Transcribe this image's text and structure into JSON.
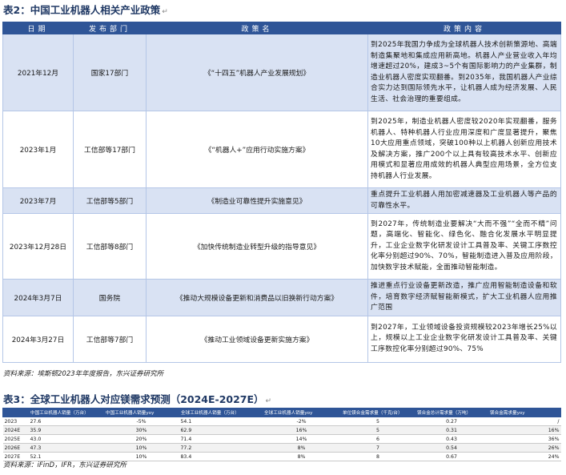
{
  "table1": {
    "title": "表2：中国工业机器人相关产业政策",
    "headers": [
      "日期",
      "发布部门",
      "政策名",
      "政策内容"
    ],
    "rows": [
      {
        "date": "2021年12月",
        "dept": "国家17部门",
        "name": "《“十四五”机器人产业发展规划》",
        "content": "到2025年我国力争成为全球机器人技术创新策源地、高端制造集聚地和集成应用新高地。机器人产业营业收入年均增速超过20%，建成3~5个有国际影响力的产业集群，制造业机器人密度实现翻番。到2035年，我国机器人产业综合实力达到国际领先水平，让机器人成为经济发展、人民生活、社会治理的重要组成。"
      },
      {
        "date": "2023年1月",
        "dept": "工信部等17部门",
        "name": "《“机器人+”应用行动实施方案》",
        "content": "到2025年，制造业机器人密度较2020年实现翻番，服务机器人、特种机器人行业应用深度和广度显著提升，聚焦10大应用重点领域，突破100种以上机器人创新应用技术及解决方案，推广200个以上具有较高技术水平、创新应用模式和显著应用成效的机器人典型应用场景，全方位支持机器人行业发展。"
      },
      {
        "date": "2023年7月",
        "dept": "工信部等5部门",
        "name": "《制造业可靠性提升实施意见》",
        "content": "重点提升工业机器人用加密减速器及工业机器人等产品的可靠性水平。"
      },
      {
        "date": "2023年12月28日",
        "dept": "工信部等8部门",
        "name": "《加快传统制造业转型升级的指导意见》",
        "content": "到2027年，传统制造业要解决“大而不强”“全而不精”问题，高端化、智能化、绿色化、融合化发展水平明显提升，工业企业数字化研发设计工具普及率、关键工序数控化率分别超过90%、70%，智能制造进入普及应用阶段，加快数字技术赋能，全面推动智能制造。"
      },
      {
        "date": "2024年3月7日",
        "dept": "国务院",
        "name": "《推动大规模设备更新和消费品以旧换新行动方案》",
        "content": "推进重点行业设备更新改造，推广应用智能制造设备和软件，培育数字经济赋智能新模式，扩大工业机器人应用推广范围"
      },
      {
        "date": "2024年3月27日",
        "dept": "工信部等7部门",
        "name": "《推动工业领域设备更新实施方案》",
        "content": "到2027年，工业领域设备投资规模较2023年增长25%以上，规模以上工业企业数字化研发设计工具普及率、关键工序数控化率分别超过90%、75%"
      }
    ],
    "source": "资料来源：埃斯顿2023年年度报告，东兴证券研究所"
  },
  "table2": {
    "title": "表3：全球工业机器人对应镁需求预测（2024E-2027E）",
    "headers": [
      "中国工业机器人销量（万台）",
      "中国工业机器人销量yoy",
      "全球工业机器人销量（万台）",
      "全球工业机器人销量yoy",
      "单位镁合金需求量（千克/台）",
      "镁合金总计需求量（万吨）",
      "镁合金需求量yoy"
    ],
    "rows": [
      [
        "2023",
        "27.6",
        "-5%",
        "54.1",
        "-2%",
        "5",
        "0.27",
        "/"
      ],
      [
        "2024E",
        "35.9",
        "30%",
        "62.9",
        "16%",
        "5",
        "0.31",
        "16%"
      ],
      [
        "2025E",
        "43.0",
        "20%",
        "71.4",
        "14%",
        "6",
        "0.43",
        "36%"
      ],
      [
        "2026E",
        "47.3",
        "10%",
        "77.2",
        "8%",
        "7",
        "0.54",
        "26%"
      ],
      [
        "2027E",
        "52.1",
        "10%",
        "83.4",
        "8%",
        "8",
        "0.67",
        "24%"
      ]
    ],
    "source": "资料来源：iFinD，IFR，东兴证券研究所"
  },
  "marks": {
    "return_glyph": "↵"
  }
}
